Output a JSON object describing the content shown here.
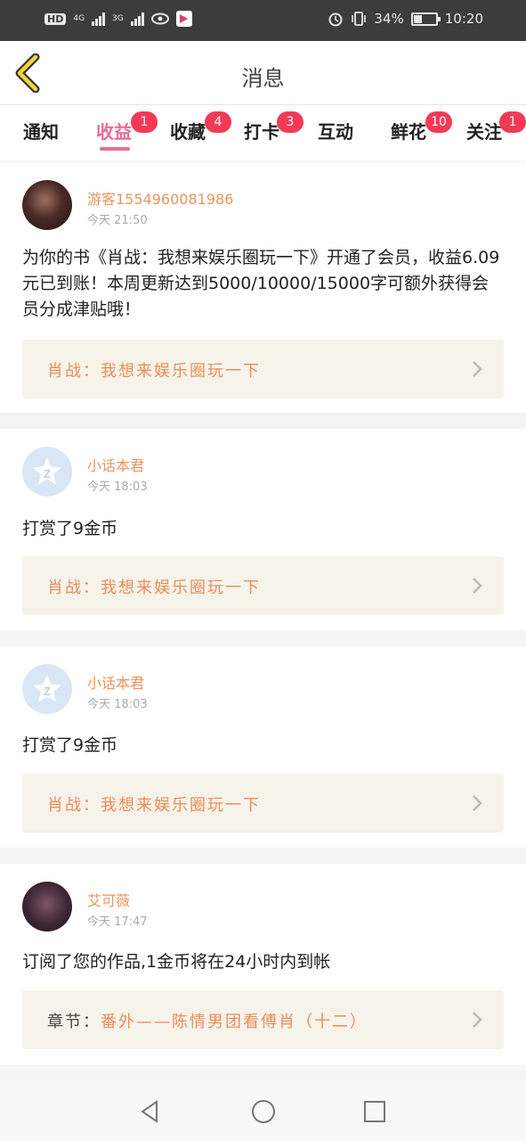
{
  "status_bar": {
    "hd_label": "HD",
    "signal1_label": "4G",
    "signal2_label": "3G",
    "battery_percent": "34%",
    "time": "10:20",
    "icons": [
      "eye-icon",
      "app-icon",
      "alarm-icon",
      "vibrate-icon",
      "battery-icon"
    ]
  },
  "header": {
    "title": "消息"
  },
  "tabs": [
    {
      "label": "通知",
      "badge": ""
    },
    {
      "label": "收益",
      "badge": "1"
    },
    {
      "label": "收藏",
      "badge": "4"
    },
    {
      "label": "打卡",
      "badge": "3"
    },
    {
      "label": "互动",
      "badge": ""
    },
    {
      "label": "鲜花",
      "badge": "10"
    },
    {
      "label": "关注",
      "badge": "1"
    }
  ],
  "active_tab": "收益",
  "accent_color": "#e56d98",
  "messages": [
    {
      "username": "游客1554960081986",
      "time": "今天 21:50",
      "text": "为你的书《肖战：我想来娱乐圈玩一下》开通了会员，收益6.09元已到账！本周更新达到5000/10000/15000字可额外获得会员分成津贴哦！",
      "book_prefix": "",
      "book_title": "肖战：我想来娱乐圈玩一下"
    },
    {
      "username": "小话本君",
      "time": "今天 18:03",
      "text": "打赏了9金币",
      "book_prefix": "",
      "book_title": "肖战：我想来娱乐圈玩一下"
    },
    {
      "username": "小话本君",
      "time": "今天 18:03",
      "text": "打赏了9金币",
      "book_prefix": "",
      "book_title": "肖战：我想来娱乐圈玩一下"
    },
    {
      "username": "艾可薇",
      "time": "今天 17:47",
      "text": "订阅了您的作品,1金币将在24小时内到帐",
      "book_prefix": "章节：",
      "book_title": "番外——陈情男团看傅肖（十二）"
    }
  ]
}
